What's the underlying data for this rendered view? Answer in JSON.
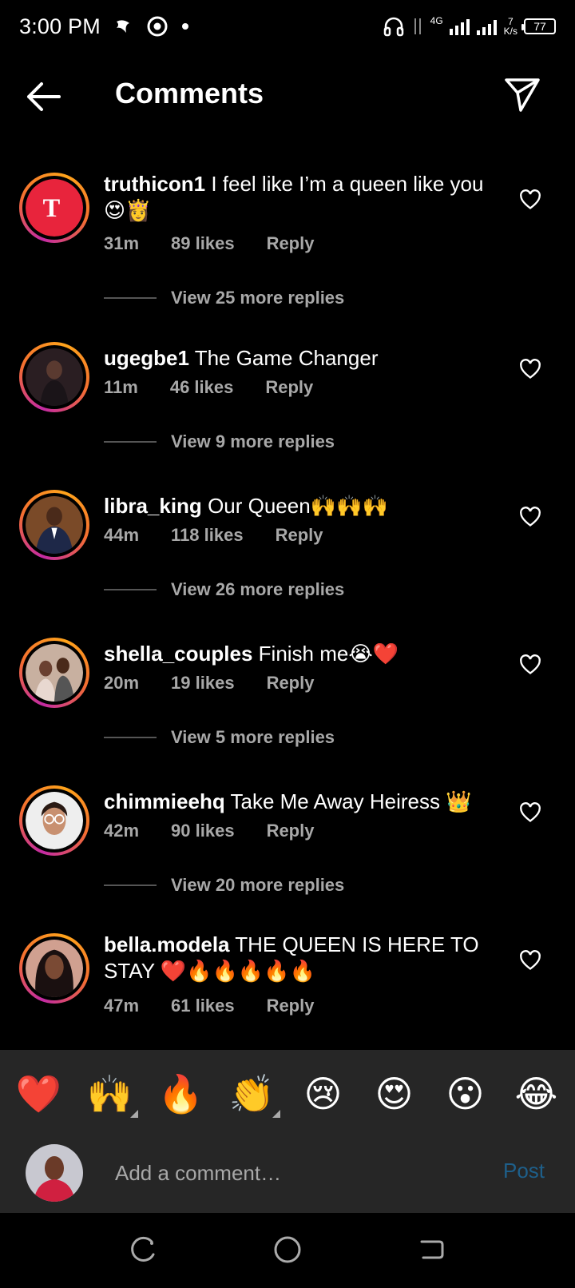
{
  "status": {
    "time": "3:00 PM",
    "network": "4G",
    "speed_value": "7",
    "speed_unit": "K/s",
    "battery": "77"
  },
  "header": {
    "title": "Comments"
  },
  "comments": [
    {
      "username": "truthicon1",
      "text": "I feel like I’m a queen like you 😍👸",
      "time": "31m",
      "likes": "89 likes",
      "reply": "Reply",
      "view_replies": "View 25 more replies",
      "avatar_color": "#e8243c"
    },
    {
      "username": "ugegbe1",
      "text": "The Game Changer",
      "time": "11m",
      "likes": "46 likes",
      "reply": "Reply",
      "view_replies": "View 9 more replies",
      "avatar_color": "#3a2a2a"
    },
    {
      "username": "libra_king",
      "text": "Our Queen🙌🙌🙌",
      "time": "44m",
      "likes": "118 likes",
      "reply": "Reply",
      "view_replies": "View 26 more replies",
      "avatar_color": "#5a3a22"
    },
    {
      "username": "shella_couples",
      "text": "Finish me😭❤️",
      "time": "20m",
      "likes": "19 likes",
      "reply": "Reply",
      "view_replies": "View 5 more replies",
      "avatar_color": "#b89a88"
    },
    {
      "username": "chimmieehq",
      "text": "Take Me Away Heiress 👑",
      "time": "42m",
      "likes": "90 likes",
      "reply": "Reply",
      "view_replies": "View 20 more replies",
      "avatar_color": "#d8c8c0"
    },
    {
      "username": "bella.modela",
      "text": "THE QUEEN IS HERE TO STAY ❤️🔥🔥🔥🔥🔥",
      "time": "47m",
      "likes": "61 likes",
      "reply": "Reply",
      "view_replies": "",
      "avatar_color": "#6a4030"
    }
  ],
  "emoji_bar": [
    "❤️",
    "🙌",
    "🔥",
    "👏",
    "😢",
    "😍",
    "😮",
    "😂"
  ],
  "add_comment": {
    "placeholder": "Add a comment…",
    "post_label": "Post"
  },
  "colors": {
    "accent_post": "#1e5f8a",
    "muted_text": "#a8a8a8",
    "bar_bg": "#262626"
  }
}
